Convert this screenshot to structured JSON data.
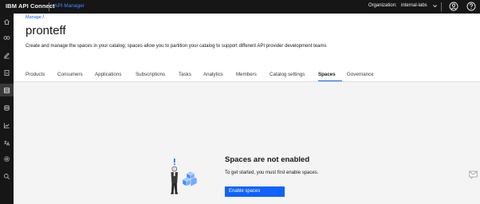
{
  "topbar": {
    "brand": "IBM API Connect",
    "product": "API Manager",
    "org_label": "Organization:",
    "org_value": "internal-labs"
  },
  "leftnav": {
    "items": [
      {
        "icon": "home-icon"
      },
      {
        "icon": "connections-icon"
      },
      {
        "icon": "edit-icon"
      },
      {
        "icon": "catalog-icon"
      },
      {
        "icon": "manage-icon",
        "active": true
      },
      {
        "icon": "database-icon"
      },
      {
        "icon": "analytics-icon"
      },
      {
        "icon": "translate-icon"
      },
      {
        "icon": "settings-icon"
      },
      {
        "icon": "search-icon"
      }
    ]
  },
  "breadcrumb": {
    "manage": "Manage",
    "separator": "/"
  },
  "page": {
    "title": "pronteff",
    "description": "Create and manage the spaces in your catalog; spaces allow you to partition your catalog to support different API provider development teams"
  },
  "tabs": [
    {
      "label": "Products"
    },
    {
      "label": "Consumers"
    },
    {
      "label": "Applications"
    },
    {
      "label": "Subscriptions"
    },
    {
      "label": "Tasks"
    },
    {
      "label": "Analytics"
    },
    {
      "label": "Members"
    },
    {
      "label": "Catalog settings"
    },
    {
      "label": "Spaces",
      "active": true
    },
    {
      "label": "Governance"
    }
  ],
  "empty_state": {
    "title": "Spaces are not enabled",
    "text": "To get started, you must first enable spaces.",
    "button": "Enable spaces"
  },
  "colors": {
    "topbar_bg": "#161616",
    "accent": "#0f62fe",
    "content_bg": "#f4f4f4"
  }
}
